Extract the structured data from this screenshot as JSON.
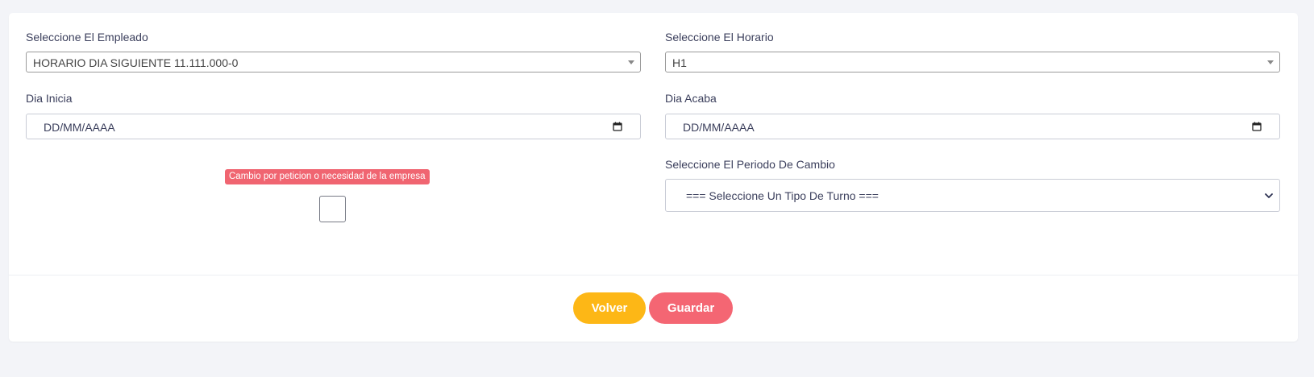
{
  "form": {
    "employee": {
      "label": "Seleccione El Empleado",
      "value": "HORARIO DIA SIGUIENTE 11.111.000-0"
    },
    "schedule": {
      "label": "Seleccione El Horario",
      "value": "H1"
    },
    "start_day": {
      "label": "Dia Inicia",
      "placeholder": "DD/MM/AAAA"
    },
    "end_day": {
      "label": "Dia Acaba",
      "placeholder": "DD/MM/AAAA"
    },
    "change_request": {
      "badge": "Cambio por peticion o necesidad de la empresa",
      "checked": false
    },
    "change_period": {
      "label": "Seleccione El Periodo De Cambio",
      "value": "=== Seleccione Un Tipo De Turno ==="
    }
  },
  "actions": {
    "back_label": "Volver",
    "save_label": "Guardar"
  },
  "colors": {
    "back_button": "#fdb716",
    "save_button": "#f46673",
    "badge": "#f06571"
  },
  "icons": {
    "calendar": "calendar-icon",
    "select_arrow": "caret-down-icon",
    "chevron": "chevron-down-icon"
  }
}
